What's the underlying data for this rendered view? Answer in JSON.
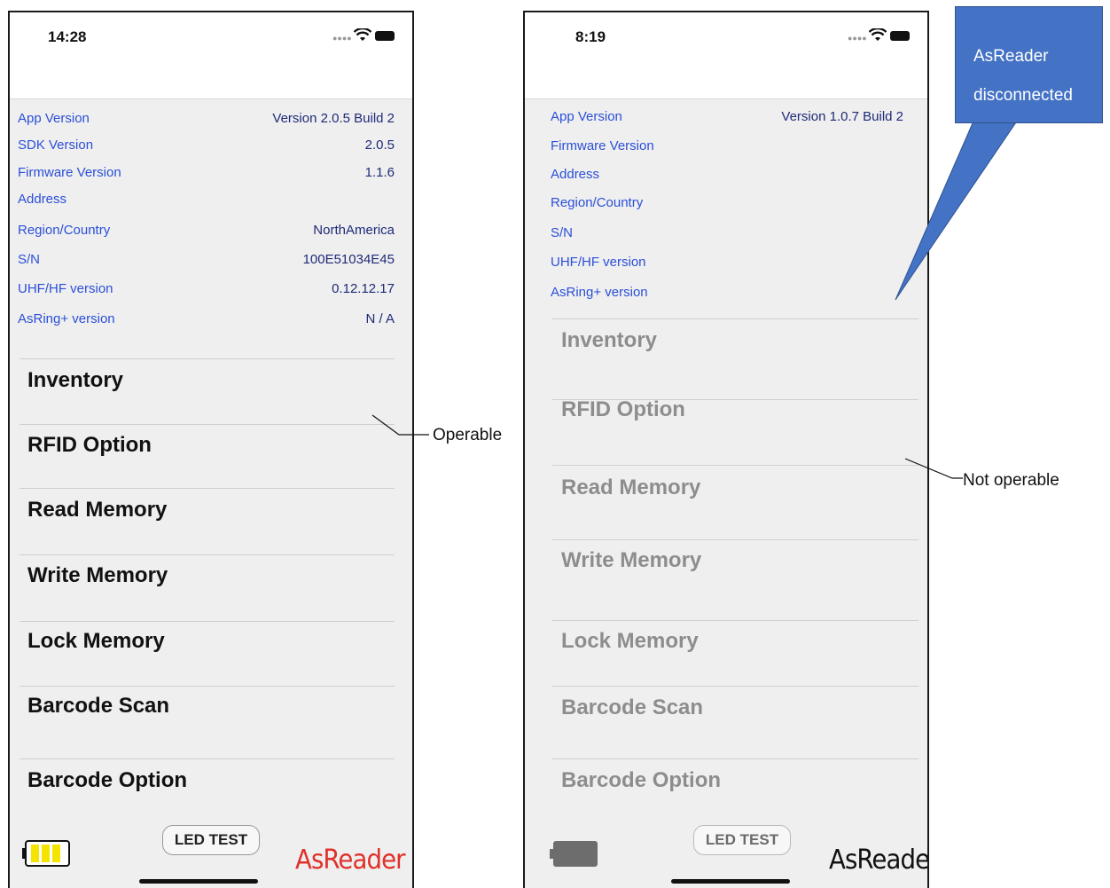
{
  "left_phone": {
    "time": "14:28",
    "info_rows": [
      {
        "label": "App Version",
        "value": "Version 2.0.5 Build 2"
      },
      {
        "label": "SDK Version",
        "value": "2.0.5"
      },
      {
        "label": "Firmware Version",
        "value": "1.1.6"
      },
      {
        "label": "Address",
        "value": ""
      },
      {
        "label": "Region/Country",
        "value": "NorthAmerica"
      },
      {
        "label": "S/N",
        "value": "100E51034E45"
      },
      {
        "label": "UHF/HF version",
        "value": "0.12.12.17"
      },
      {
        "label": "AsRing+ version",
        "value": "N / A"
      }
    ],
    "menu": [
      "Inventory",
      "RFID Option",
      "Read Memory",
      "Write Memory",
      "Lock Memory",
      "Barcode Scan",
      "Barcode Option"
    ],
    "led_button": "LED TEST",
    "logo": "AsReader",
    "battery_state": "charged",
    "annotation": "Operable"
  },
  "right_phone": {
    "time": "8:19",
    "info_rows": [
      {
        "label": "App Version",
        "value": "Version 1.0.7 Build 2"
      },
      {
        "label": "Firmware Version",
        "value": ""
      },
      {
        "label": "Address",
        "value": ""
      },
      {
        "label": "Region/Country",
        "value": ""
      },
      {
        "label": "S/N",
        "value": ""
      },
      {
        "label": "UHF/HF version",
        "value": ""
      },
      {
        "label": "AsRing+ version",
        "value": ""
      }
    ],
    "menu": [
      "Inventory",
      "RFID Option",
      "Read Memory",
      "Write Memory",
      "Lock Memory",
      "Barcode Scan",
      "Barcode Option"
    ],
    "led_button": "LED TEST",
    "logo": "AsReader",
    "battery_state": "empty",
    "annotation": "Not operable"
  },
  "callout": {
    "line1": "AsReader",
    "line2": "disconnected"
  },
  "colors": {
    "label_blue": "#2b4fd8",
    "value_navy": "#1e2a78",
    "callout_blue": "#4472c4",
    "battery_yellow": "#f5e400",
    "logo_red": "#e0312a",
    "disabled_gray": "#8d8d8d"
  },
  "icons": [
    "wifi-icon",
    "battery-icon",
    "cellular-signal-icon",
    "battery-level-icon"
  ]
}
